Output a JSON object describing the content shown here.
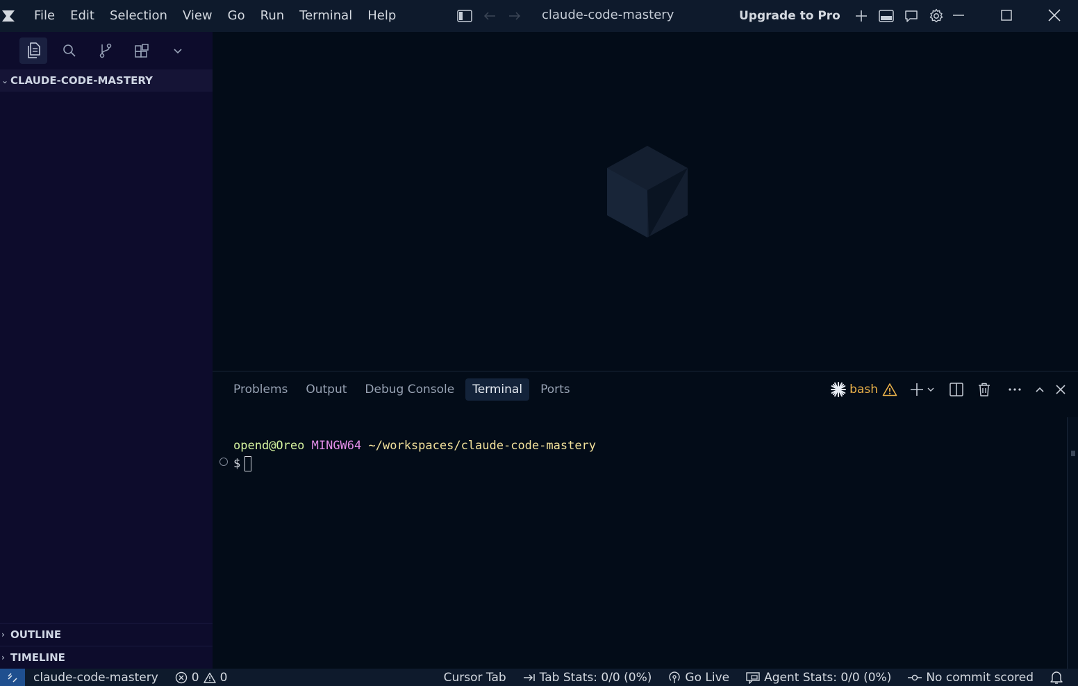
{
  "titlebar": {
    "menu": [
      "File",
      "Edit",
      "Selection",
      "View",
      "Go",
      "Run",
      "Terminal",
      "Help"
    ],
    "title": "claude-code-mastery",
    "upgrade_label": "Upgrade to Pro"
  },
  "sidebar": {
    "explorer_title": "CLAUDE-CODE-MASTERY",
    "outline_label": "OUTLINE",
    "timeline_label": "TIMELINE"
  },
  "panel": {
    "tabs": [
      "Problems",
      "Output",
      "Debug Console",
      "Terminal",
      "Ports"
    ],
    "active_tab": "Terminal",
    "terminal_name": "bash"
  },
  "terminal": {
    "user": "opend@Oreo",
    "host": "MINGW64",
    "path": "~/workspaces/claude-code-mastery",
    "prompt": "$"
  },
  "statusbar": {
    "workspace": "claude-code-mastery",
    "errors": "0",
    "warnings": "0",
    "cursor_tab": "Cursor Tab",
    "tab_stats": "Tab Stats: 0/0 (0%)",
    "go_live": "Go Live",
    "agent_stats": "Agent Stats: 0/0 (0%)",
    "commit": "No commit scored"
  },
  "colors": {
    "sidebar_bg": "#0d0c2c",
    "editor_bg": "#030c18",
    "titlebar_bg": "#0e1a2c",
    "bash_accent": "#e8b04a"
  }
}
